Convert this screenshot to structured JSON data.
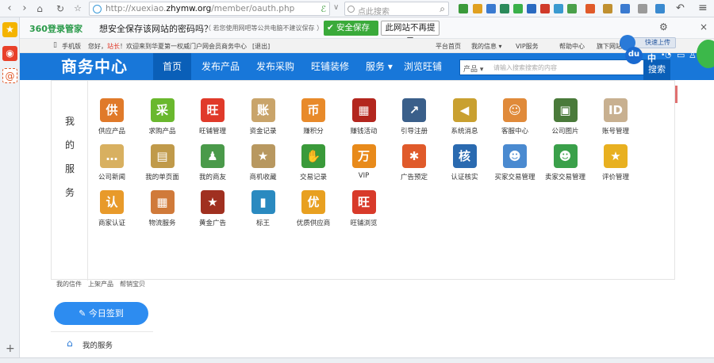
{
  "browser": {
    "url_host": "http://xuexiao.",
    "url_domain": "zhymw.org",
    "url_path": "/member/oauth.php",
    "search_placeholder": "点此搜索"
  },
  "password_bar": {
    "brand": "360登录管家",
    "prompt": "想安全保存该网站的密码吗？",
    "note": "（ 若您使用网吧等公共电脑不建议保存 ）",
    "save_button": "安全保存",
    "never_button": "此网站不再提示"
  },
  "top_strip": {
    "mobile": "手机版",
    "greeting_prefix": "您好，",
    "user": "站长",
    "welcome": "！欢迎来到华夏第一权威门户网会员商务中心",
    "logout": "[退出]",
    "links": [
      "平台首页",
      "我的信息 ▾",
      "VIP服务",
      "帮助中心",
      "旗下网站"
    ],
    "upload_button": "快速上传",
    "cloud_label": "du"
  },
  "nav": {
    "logo": "商务中心",
    "items": [
      "首页",
      "发布产品",
      "发布采购",
      "旺铺装修",
      "服务 ▾",
      "浏览旺铺"
    ],
    "search_select": "产品 ▾",
    "search_placeholder": "请输入搜索搜索的内容",
    "search_button": "搜索",
    "lang": "中"
  },
  "panel": {
    "title_chars": [
      "我",
      "的",
      "服",
      "务"
    ],
    "services": [
      {
        "label": "供应产品",
        "glyph": "供",
        "color": "#e07a2a"
      },
      {
        "label": "求购产品",
        "glyph": "采",
        "color": "#6ab82e"
      },
      {
        "label": "旺铺管理",
        "glyph": "旺",
        "color": "#e03a2a"
      },
      {
        "label": "资金记录",
        "glyph": "账",
        "color": "#c9a46a"
      },
      {
        "label": "赚积分",
        "glyph": "币",
        "color": "#e88a2a"
      },
      {
        "label": "赚钱活动",
        "glyph": "▦",
        "color": "#b3261e"
      },
      {
        "label": "引导注册",
        "glyph": "↗",
        "color": "#3a5f8a"
      },
      {
        "label": "系统消息",
        "glyph": "◀",
        "color": "#c9a030"
      },
      {
        "label": "客服中心",
        "glyph": "☺",
        "color": "#e08a3a"
      },
      {
        "label": "公司图片",
        "glyph": "▣",
        "color": "#4a7a3a"
      },
      {
        "label": "账号管理",
        "glyph": "ID",
        "color": "#c8b090"
      },
      {
        "label": "公司新闻",
        "glyph": "…",
        "color": "#d8b060"
      },
      {
        "label": "我的单页面",
        "glyph": "▤",
        "color": "#c09a4a"
      },
      {
        "label": "我的商友",
        "glyph": "♟",
        "color": "#4a9a4a"
      },
      {
        "label": "商机收藏",
        "glyph": "★",
        "color": "#b89860"
      },
      {
        "label": "交易记录",
        "glyph": "✋",
        "color": "#3a9a3a"
      },
      {
        "label": "VIP",
        "glyph": "万",
        "color": "#e88a1a"
      },
      {
        "label": "广告预定",
        "glyph": "✱",
        "color": "#e05a2a"
      },
      {
        "label": "认证核实",
        "glyph": "核",
        "color": "#2a6ab0"
      },
      {
        "label": "买家交易管理",
        "glyph": "☻",
        "color": "#4a8ad0"
      },
      {
        "label": "卖家交易管理",
        "glyph": "☻",
        "color": "#3aa04a"
      },
      {
        "label": "评价管理",
        "glyph": "★",
        "color": "#e8b020"
      },
      {
        "label": "商家认证",
        "glyph": "认",
        "color": "#e89a2a"
      },
      {
        "label": "物流服务",
        "glyph": "▦",
        "color": "#d07a3a"
      },
      {
        "label": "黄金广告",
        "glyph": "★",
        "color": "#a03020"
      },
      {
        "label": "标王",
        "glyph": "▮",
        "color": "#2a8ac0"
      },
      {
        "label": "优质供应商",
        "glyph": "优",
        "color": "#e8a020"
      },
      {
        "label": "旺铺浏览",
        "glyph": "旺",
        "color": "#d83a2a"
      }
    ]
  },
  "below": {
    "small_links": [
      "我的信件",
      "上架产品",
      "帮销宝贝"
    ],
    "checkin": "今日签到",
    "my_services": "我的服务"
  }
}
